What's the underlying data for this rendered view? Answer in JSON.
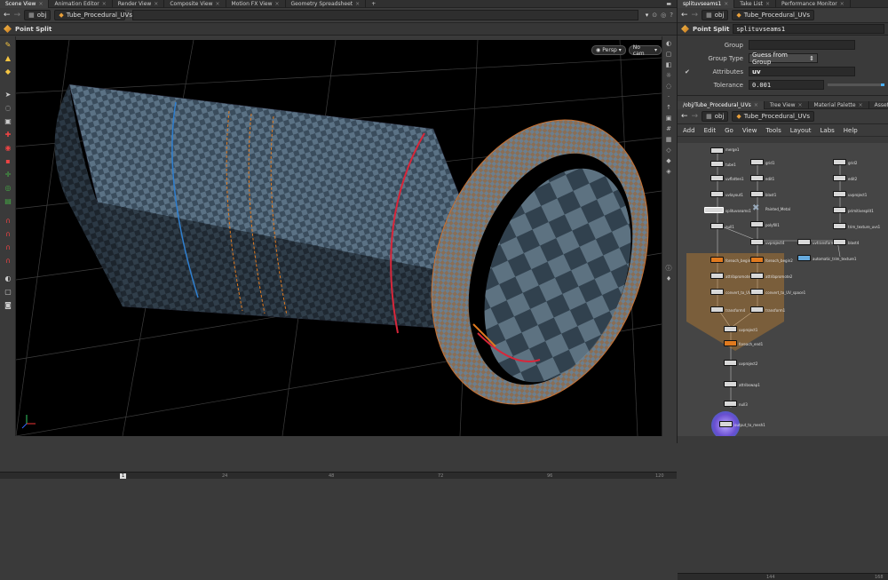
{
  "left_tabs": [
    "Scene View",
    "Animation Editor",
    "Render View",
    "Composite View",
    "Motion FX View",
    "Geometry Spreadsheet"
  ],
  "right_tabs_top": [
    "splituvseams1",
    "Take List",
    "Performance Monitor"
  ],
  "left_path": {
    "context": "obj",
    "node": "Tube_Procedural_UVs"
  },
  "right_path_top": {
    "context": "obj",
    "node": "Tube_Procedural_UVs"
  },
  "viewport": {
    "title": "Point Split",
    "camera_mode": "Persp",
    "camera": "No cam"
  },
  "parms": {
    "node_type": "Point Split",
    "node_name": "splituvseams1",
    "group_label": "Group",
    "group_value": "",
    "group_type_label": "Group Type",
    "group_type_value": "Guess from Group",
    "attributes_label": "Attributes",
    "attributes_value": "uv",
    "tolerance_label": "Tolerance",
    "tolerance_value": "0.001"
  },
  "network_tabs": [
    "/obj/Tube_Procedural_UVs",
    "Tree View",
    "Material Palette",
    "Asset Browser"
  ],
  "network_path": {
    "context": "obj",
    "node": "Tube_Procedural_UVs"
  },
  "network_menu": [
    "Add",
    "Edit",
    "Go",
    "View",
    "Tools",
    "Layout",
    "Labs",
    "Help"
  ],
  "timeline_left": [
    "1",
    "24",
    "48",
    "72",
    "96",
    "120"
  ],
  "timeline_right": [
    "144",
    "168"
  ],
  "nodes": [
    {
      "label": "merge1"
    },
    {
      "label": "tube1"
    },
    {
      "label": "uvflatten1"
    },
    {
      "label": "uvlayout1"
    },
    {
      "label": "splituvseams1"
    },
    {
      "label": "null1"
    },
    {
      "label": "grid1"
    },
    {
      "label": "edit1"
    },
    {
      "label": "blast1"
    },
    {
      "label": "Painted_Metal"
    },
    {
      "label": "polyfill1"
    },
    {
      "label": "grid2"
    },
    {
      "label": "edit2"
    },
    {
      "label": "uvproject1"
    },
    {
      "label": "primitivesplit1"
    },
    {
      "label": "trim_texture_uvs1"
    },
    {
      "label": "uvproject4"
    },
    {
      "label": "uvtransform1"
    },
    {
      "label": "blast4"
    },
    {
      "label": "automatic_trim_texture1"
    },
    {
      "label": "foreach_begin1"
    },
    {
      "label": "foreach_begin2"
    },
    {
      "label": "attribpromote1"
    },
    {
      "label": "attribpromote2"
    },
    {
      "label": "convert_to_UV_space"
    },
    {
      "label": "convert_to_UV_space1"
    },
    {
      "label": "transform4"
    },
    {
      "label": "transform1"
    },
    {
      "label": "uvproject1"
    },
    {
      "label": "foreach_end1"
    },
    {
      "label": "uvproject2"
    },
    {
      "label": "attribswap1"
    },
    {
      "label": "null3"
    },
    {
      "label": "output_to_mesh1"
    }
  ]
}
